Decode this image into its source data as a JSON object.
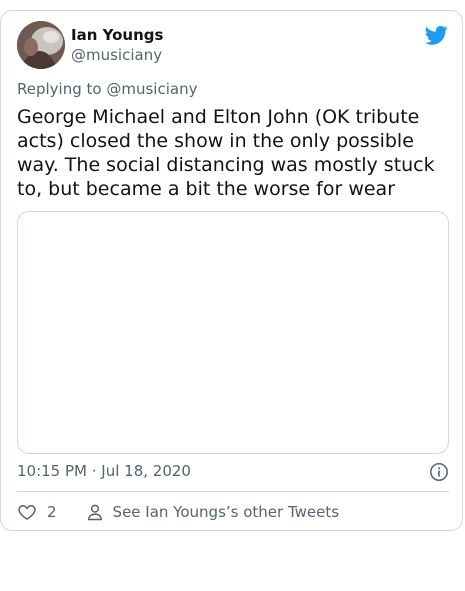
{
  "author": {
    "name": "Ian Youngs",
    "handle": "@musiciany"
  },
  "reply": {
    "prefix": "Replying to",
    "handle": "@musiciany"
  },
  "tweet": {
    "text": "George Michael and Elton John (OK tribute acts) closed the show in the only possible way. The social distancing was mostly stuck to, but became a bit the worse for wear",
    "timestamp": "10:15 PM · Jul 18, 2020"
  },
  "actions": {
    "like_count": "2",
    "other_tweets_label": "See Ian Youngs’s other Tweets"
  },
  "colors": {
    "twitter_blue": "#1d9bf0",
    "text_primary": "#0f1419",
    "text_secondary": "#536471",
    "border": "#cfd9de"
  },
  "icons": {
    "brand": "twitter-bird-icon",
    "info": "info-icon",
    "like": "heart-icon",
    "profile": "person-icon"
  }
}
